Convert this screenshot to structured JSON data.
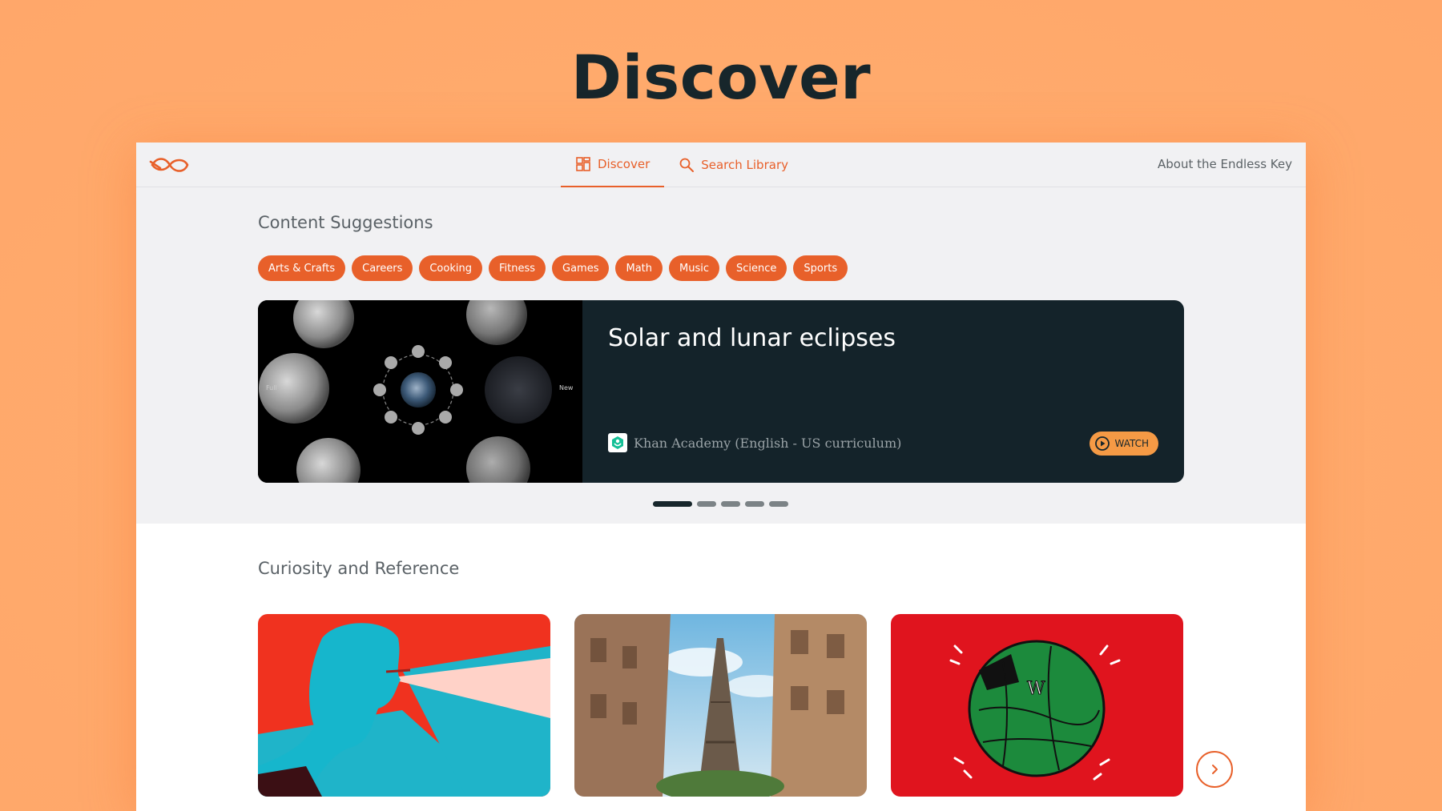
{
  "hero": {
    "title": "Discover"
  },
  "nav": {
    "discover_label": "Discover",
    "search_label": "Search Library",
    "about_label": "About the Endless Key"
  },
  "suggestions": {
    "title": "Content Suggestions",
    "chips": [
      "Arts & Crafts",
      "Careers",
      "Cooking",
      "Fitness",
      "Games",
      "Math",
      "Music",
      "Science",
      "Sports"
    ],
    "featured": {
      "title": "Solar and lunar eclipses",
      "channel": "Khan Academy (English - US curriculum)",
      "watch_label": "WATCH",
      "thumb_left_label": "Full",
      "thumb_right_label": "New"
    },
    "carousel_pages": 5,
    "carousel_active": 0
  },
  "curiosity": {
    "title": "Curiosity and Reference"
  },
  "colors": {
    "accent": "#e8602a",
    "dark": "#17262b",
    "background": "#ffaa6c"
  }
}
